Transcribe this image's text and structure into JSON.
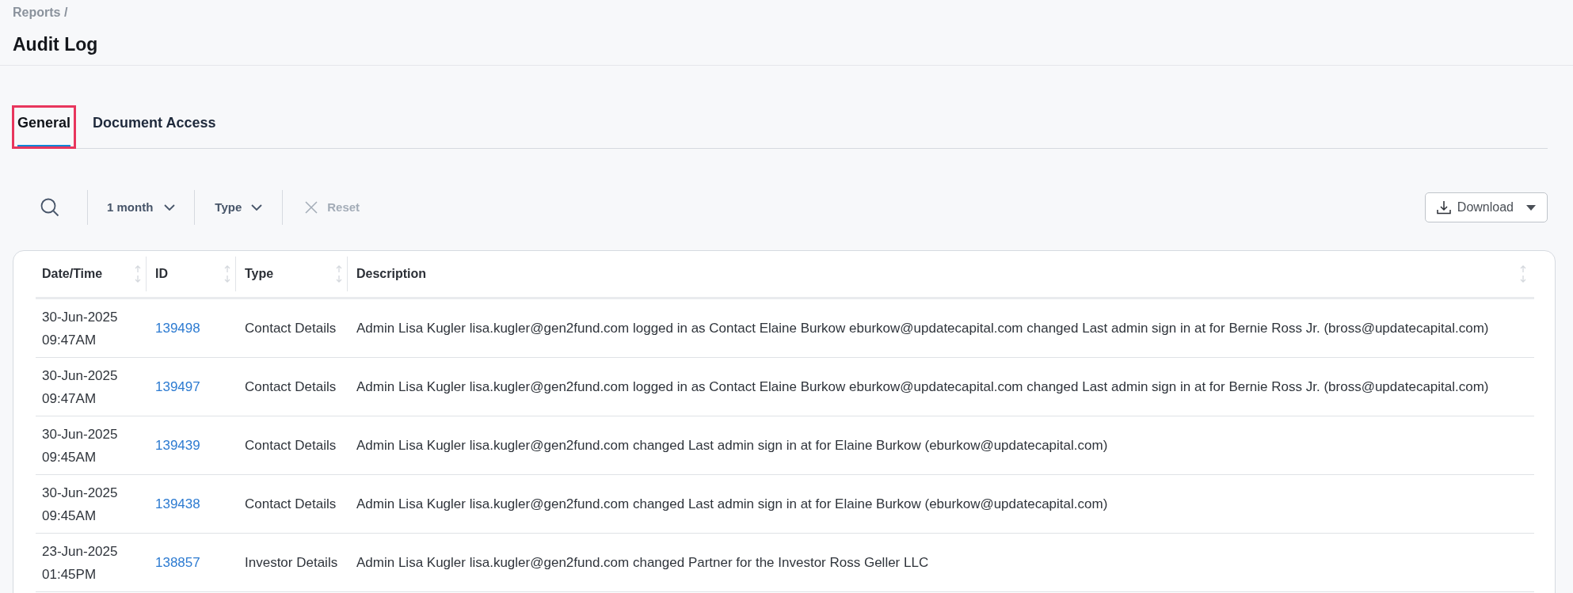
{
  "breadcrumb": "Reports /",
  "title": "Audit Log",
  "tabs": [
    {
      "label": "General",
      "selected": true,
      "highlighted": true
    },
    {
      "label": "Document Access",
      "selected": false,
      "highlighted": false
    }
  ],
  "toolbar": {
    "period": "1 month",
    "type": "Type",
    "reset": {
      "label": "Reset",
      "disabled": true
    },
    "download": "Download"
  },
  "table": {
    "columns": [
      "Date/Time",
      "ID",
      "Type",
      "Description"
    ],
    "rows": [
      {
        "date": "30-Jun-2025",
        "time": "09:47AM",
        "id": "139498",
        "type": "Contact Details",
        "description": "Admin Lisa Kugler lisa.kugler@gen2fund.com logged in as Contact Elaine Burkow eburkow@updatecapital.com changed Last admin sign in at for Bernie Ross Jr. (bross@updatecapital.com)"
      },
      {
        "date": "30-Jun-2025",
        "time": "09:47AM",
        "id": "139497",
        "type": "Contact Details",
        "description": "Admin Lisa Kugler lisa.kugler@gen2fund.com logged in as Contact Elaine Burkow eburkow@updatecapital.com changed Last admin sign in at for Bernie Ross Jr. (bross@updatecapital.com)"
      },
      {
        "date": "30-Jun-2025",
        "time": "09:45AM",
        "id": "139439",
        "type": "Contact Details",
        "description": "Admin Lisa Kugler lisa.kugler@gen2fund.com changed Last admin sign in at for Elaine Burkow (eburkow@updatecapital.com)"
      },
      {
        "date": "30-Jun-2025",
        "time": "09:45AM",
        "id": "139438",
        "type": "Contact Details",
        "description": "Admin Lisa Kugler lisa.kugler@gen2fund.com changed Last admin sign in at for Elaine Burkow (eburkow@updatecapital.com)"
      },
      {
        "date": "23-Jun-2025",
        "time": "01:45PM",
        "id": "138857",
        "type": "Investor Details",
        "description": "Admin Lisa Kugler lisa.kugler@gen2fund.com changed Partner for the Investor Ross Geller LLC"
      }
    ]
  }
}
